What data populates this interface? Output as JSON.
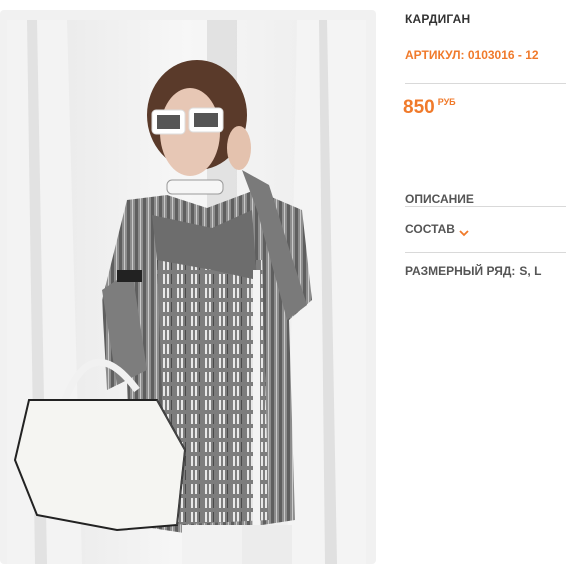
{
  "product": {
    "title": "КАРДИГАН",
    "sku": "АРТИКУЛ: 0103016 - 12",
    "price": "850",
    "currency": "РУБ",
    "description_label": "ОПИСАНИЕ",
    "composition_label": "СОСТАВ",
    "sizes_label": "РАЗМЕРНЫЙ РЯД:",
    "sizes_value": "S, L"
  },
  "colors": {
    "accent": "#f07a2b",
    "text": "#333333",
    "separator": "#d9d9d9"
  },
  "icons": {
    "composition_toggle": "chevron-down-icon"
  }
}
